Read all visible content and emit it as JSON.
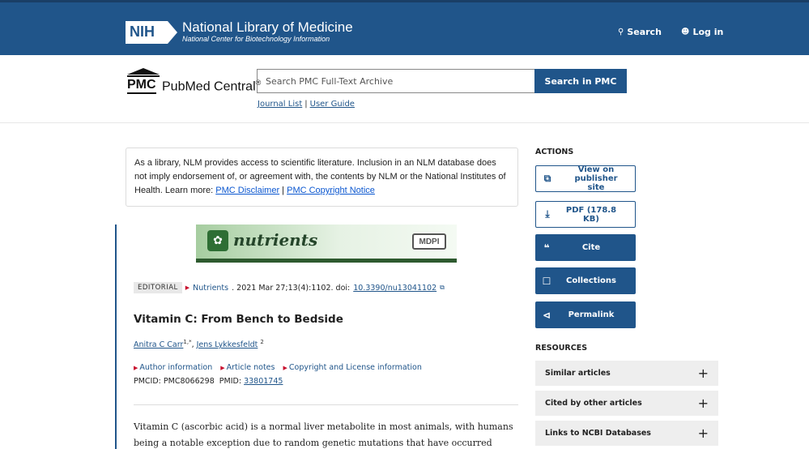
{
  "header": {
    "logo_abbr": "NIH",
    "title": "National Library of Medicine",
    "subtitle": "National Center for Biotechnology Information",
    "search_label": "Search",
    "login_label": "Log in"
  },
  "pmc": {
    "logo_letters": "PMC",
    "logo_name": "PubMed Central",
    "logo_reg": "®",
    "search_placeholder": "Search PMC Full-Text Archive",
    "search_button": "Search in PMC",
    "journal_list": "Journal List",
    "separator": "|",
    "user_guide": "User Guide"
  },
  "notice": {
    "text": "As a library, NLM provides access to scientific literature. Inclusion in an NLM database does not imply endorsement of, or agreement with, the contents by NLM or the National Institutes of Health. Learn more: ",
    "link1": "PMC Disclaimer",
    "sep": " | ",
    "link2": "PMC Copyright Notice"
  },
  "banner": {
    "journal": "nutrients",
    "publisher": "MDPI"
  },
  "article": {
    "type_tag": "EDITORIAL",
    "journal": "Nutrients",
    "citation": ". 2021 Mar 27;13(4):1102. doi: ",
    "doi": "10.3390/nu13041102",
    "title": "Vitamin C: From Bench to Bedside",
    "author1": "Anitra C Carr",
    "author1_sup": "1,*",
    "author_sep": ", ",
    "author2": "Jens Lykkesfeldt",
    "author2_sup": "2",
    "meta_links": [
      "Author information",
      "Article notes",
      "Copyright and License information"
    ],
    "ids_prefix": "PMCID: PMC8066298  PMID: ",
    "pmid": "33801745",
    "abstract": "Vitamin C (ascorbic acid) is a normal liver metabolite in most animals, with humans being a notable exception due to random genetic mutations that have occurred during our evolution."
  },
  "actions": {
    "heading": "ACTIONS",
    "view_publisher": "View on publisher site",
    "pdf": "PDF (178.8 KB)",
    "cite": "Cite",
    "collections": "Collections",
    "permalink": "Permalink"
  },
  "resources": {
    "heading": "RESOURCES",
    "items": [
      "Similar articles",
      "Cited by other articles",
      "Links to NCBI Databases"
    ]
  }
}
